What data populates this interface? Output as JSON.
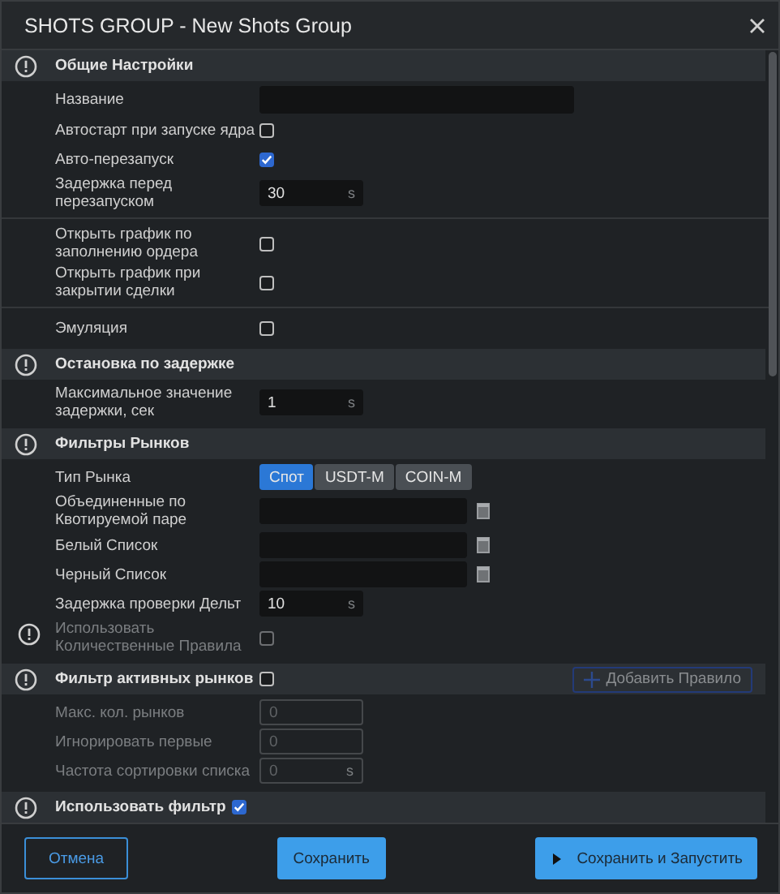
{
  "window": {
    "title": "SHOTS GROUP - New Shots Group"
  },
  "sections": [
    {
      "title": "Общие Настройки",
      "rows": [
        {
          "kind": "text",
          "label": "Название"
        },
        {
          "kind": "checkbox",
          "label": "Автостарт при запуске ядра",
          "checked": false
        },
        {
          "kind": "checkbox",
          "label": "Авто-перезапуск",
          "checked": true
        },
        {
          "kind": "number",
          "label": "Задержка перед перезапуском",
          "value": "30",
          "unit": "s"
        },
        {
          "kind": "checkbox",
          "label": "Открыть график по заполнению ордера",
          "checked": false,
          "separator_before": true
        },
        {
          "kind": "checkbox",
          "label": "Открыть график при закрытии сделки",
          "checked": false
        },
        {
          "kind": "checkbox",
          "label": "Эмуляция",
          "checked": false,
          "separator_before": true
        }
      ]
    },
    {
      "title": "Остановка по задержке",
      "rows": [
        {
          "kind": "number",
          "label": "Максимальное значение задержки, сек",
          "value": "1",
          "unit": "s"
        }
      ]
    },
    {
      "title": "Фильтры Рынков",
      "rows": [
        {
          "kind": "segmented",
          "label": "Тип Рынка",
          "options": [
            {
              "label": "Спот",
              "selected": true
            },
            {
              "label": "USDT-M",
              "selected": false
            },
            {
              "label": "COIN-M",
              "selected": false
            }
          ]
        },
        {
          "kind": "list",
          "label": "Объединенные по Квотируемой паре"
        },
        {
          "kind": "list",
          "label": "Белый Список"
        },
        {
          "kind": "list",
          "label": "Черный Список"
        },
        {
          "kind": "number",
          "label": "Задержка проверки Дельт",
          "value": "10",
          "unit": "s"
        },
        {
          "kind": "checkbox",
          "label": "Использовать Количественные Правила",
          "checked": false,
          "disabled": true,
          "info": true
        }
      ]
    },
    {
      "title": "Фильтр активных рынков",
      "checked": false,
      "action": "Добавить Правило",
      "rows": [
        {
          "kind": "number",
          "label": "Макс. кол. рынков",
          "value": "0",
          "disabled": true
        },
        {
          "kind": "number",
          "label": "Игнорировать первые",
          "value": "0",
          "disabled": true
        },
        {
          "kind": "number",
          "label": "Частота сортировки списка",
          "value": "0",
          "unit": "s",
          "disabled": true
        }
      ]
    },
    {
      "title": "Использовать фильтр",
      "checked": true
    }
  ],
  "footer": {
    "cancel": "Отмена",
    "save": "Сохранить",
    "save_run": "Сохранить и Запустить"
  }
}
